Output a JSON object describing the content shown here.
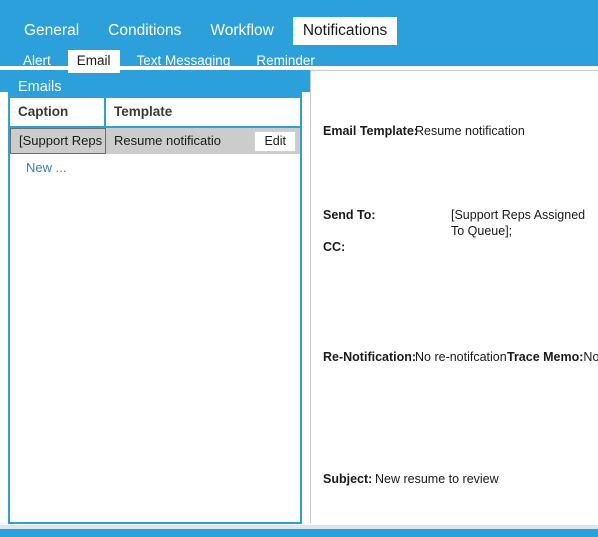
{
  "theme": {
    "accent": "#2ba0db",
    "selected_row_bg": "#cccccc",
    "link_color": "#3a7fb5"
  },
  "main_tabs": [
    {
      "label": "General",
      "active": false
    },
    {
      "label": "Conditions",
      "active": false
    },
    {
      "label": "Workflow",
      "active": false
    },
    {
      "label": "Notifications",
      "active": true
    }
  ],
  "sub_tabs": [
    {
      "label": "Alert",
      "active": false
    },
    {
      "label": "Email",
      "active": true
    },
    {
      "label": "Text Messaging",
      "active": false
    },
    {
      "label": "Reminder",
      "active": false
    }
  ],
  "emails_panel": {
    "title": "Emails",
    "columns": [
      "Caption",
      "Template"
    ],
    "rows": [
      {
        "caption": "[Support Reps A",
        "template": "Resume notificatio",
        "edit_label": "Edit",
        "selected": true
      }
    ],
    "new_row_label": "New ..."
  },
  "details": {
    "email_template_label": "Email Template:",
    "email_template_value": "Resume notification",
    "send_to_label": "Send To:",
    "send_to_value": "[Support Reps Assigned To Queue];",
    "cc_label": "CC:",
    "cc_value": "",
    "renotification_label": "Re-Notification:",
    "renotification_value": "No re-notifcation",
    "trace_memo_label": "Trace Memo:",
    "trace_memo_value": "No",
    "subject_label": "Subject:",
    "subject_value": "New resume to review"
  }
}
